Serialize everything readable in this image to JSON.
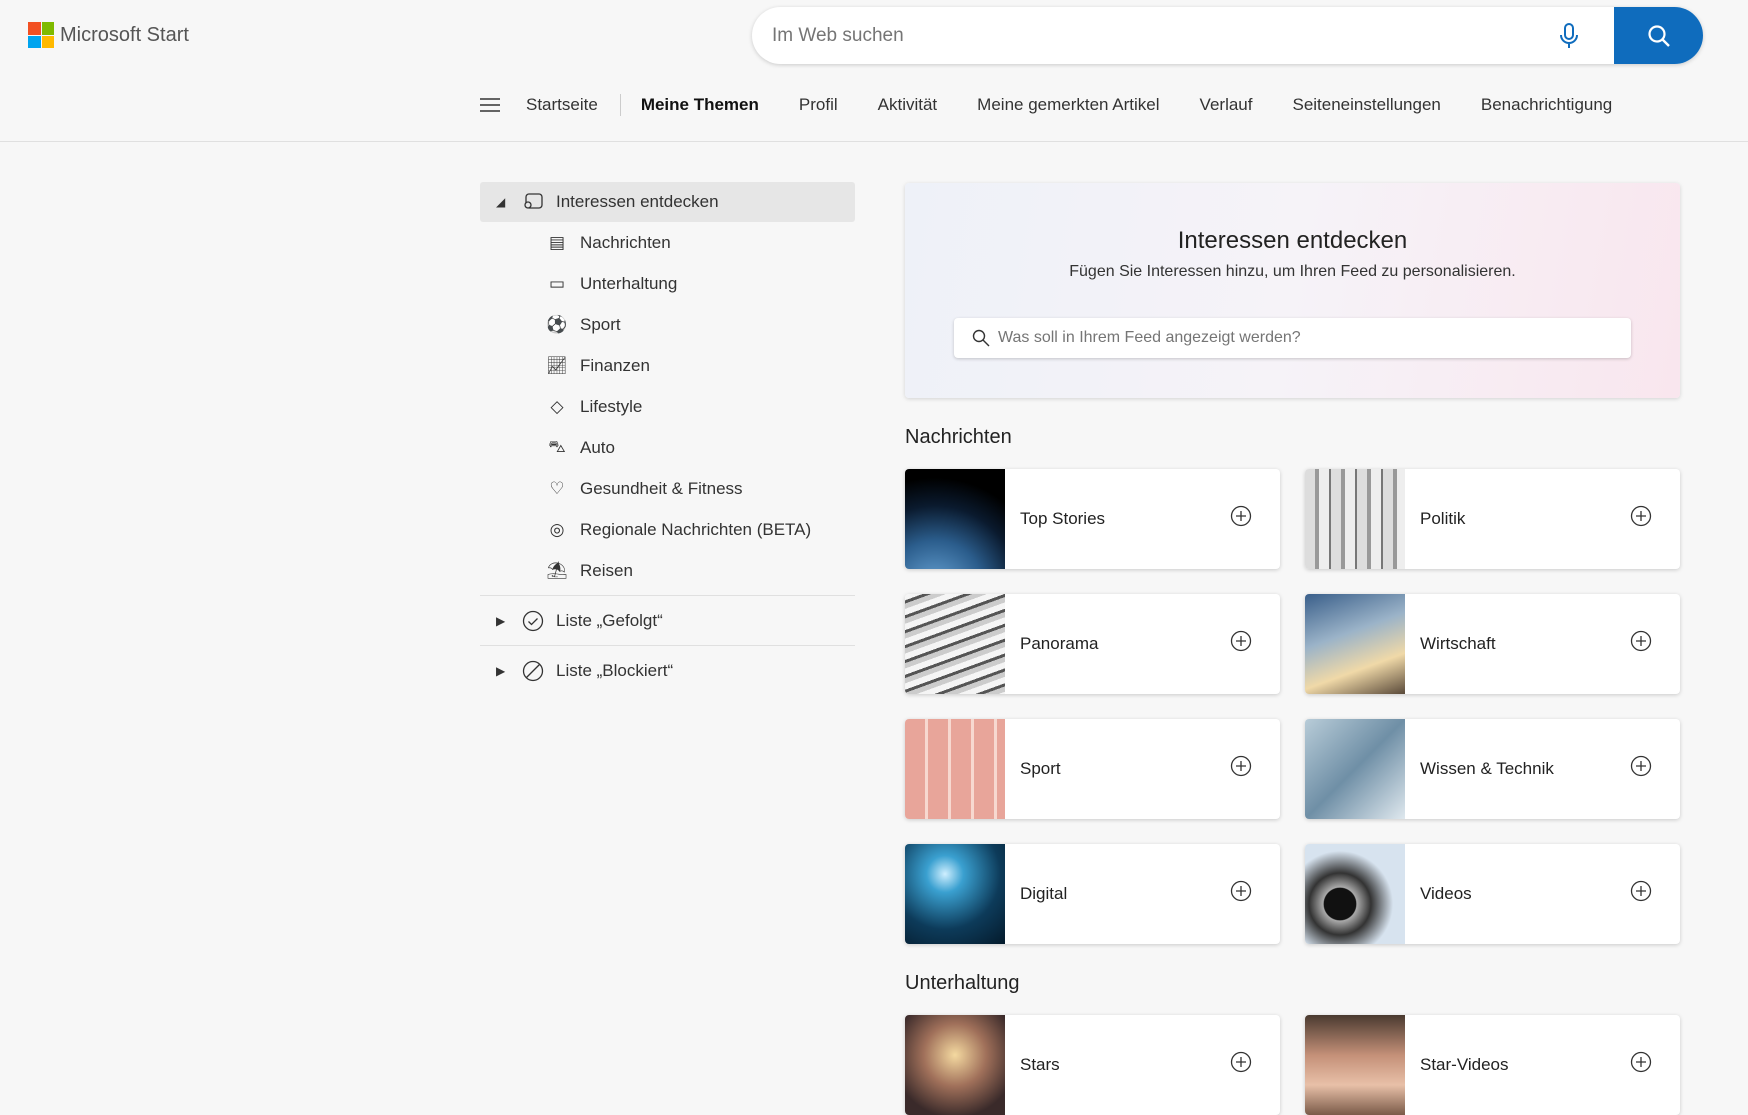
{
  "header": {
    "brand": "Microsoft Start",
    "search_placeholder": "Im Web suchen"
  },
  "nav": {
    "items": [
      "Startseite",
      "Meine Themen",
      "Profil",
      "Aktivität",
      "Meine gemerkten Artikel",
      "Verlauf",
      "Seiteneinstellungen",
      "Benachrichtigung"
    ],
    "selected": "Meine Themen"
  },
  "sidebar": {
    "top": "Interessen entdecken",
    "items": [
      "Nachrichten",
      "Unterhaltung",
      "Sport",
      "Finanzen",
      "Lifestyle",
      "Auto",
      "Gesundheit & Fitness",
      "Regionale Nachrichten (BETA)",
      "Reisen"
    ],
    "followed": "Liste „Gefolgt“",
    "blocked": "Liste „Blockiert“"
  },
  "hero": {
    "title": "Interessen entdecken",
    "subtitle": "Fügen Sie Interessen hinzu, um Ihren Feed zu personalisieren.",
    "placeholder": "Was soll in Ihrem Feed angezeigt werden?"
  },
  "sections": [
    {
      "title": "Nachrichten",
      "cards": [
        "Top Stories",
        "Politik",
        "Panorama",
        "Wirtschaft",
        "Sport",
        "Wissen & Technik",
        "Digital",
        "Videos"
      ]
    },
    {
      "title": "Unterhaltung",
      "cards": [
        "Stars",
        "Star-Videos"
      ]
    }
  ],
  "colors": {
    "accent": "#0f6cbd"
  }
}
